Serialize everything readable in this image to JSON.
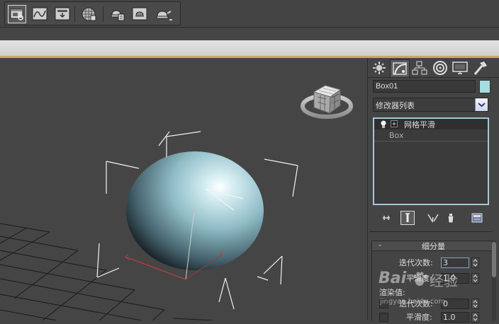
{
  "toolbar": {
    "buttons": [
      {
        "icon": "scene-explorer-icon"
      },
      {
        "icon": "curve-editor-icon"
      },
      {
        "icon": "schematic-view-icon"
      },
      {
        "icon": "material-editor-icon"
      },
      {
        "icon": "render-setup-icon"
      },
      {
        "icon": "rendered-frame-window-icon"
      },
      {
        "icon": "render-teapot-icon"
      }
    ]
  },
  "panel": {
    "tabs": [
      "create-icon",
      "modify-icon",
      "hierarchy-icon",
      "motion-icon",
      "display-icon",
      "utilities-icon"
    ],
    "object_name": "Box01",
    "object_color": "#a7dce0",
    "modifier_list_label": "修改器列表",
    "stack": {
      "items": [
        {
          "label": "网格平滑"
        },
        {
          "label": "Box"
        }
      ]
    },
    "rollout": {
      "toggle": "-",
      "title": "细分量",
      "iterations_label": "迭代次数:",
      "iterations_value": "3",
      "smoothness_label": "平滑度:",
      "smoothness_value": "1.0",
      "render_values_label": "渲染值:",
      "render_iterations_label": "迭代次数:",
      "render_iterations_value": "0",
      "render_smoothness_label": "平滑度:",
      "render_smoothness_value": "1.0"
    }
  },
  "watermark": {
    "brand": "Bai",
    "product": "经验",
    "url": "jingyan.baidu.com"
  }
}
